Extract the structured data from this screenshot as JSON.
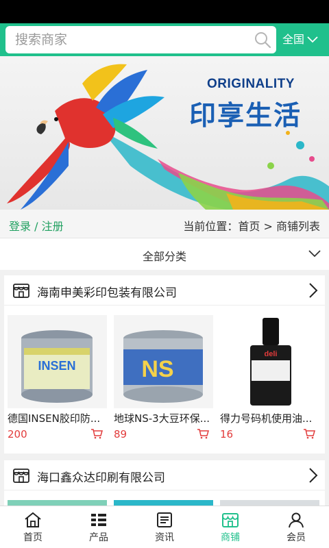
{
  "search": {
    "placeholder": "搜索商家",
    "region": "全国"
  },
  "banner": {
    "title_en": "ORIGINALITY",
    "title_cn": "印享生活"
  },
  "breadcrumb": {
    "login": "登录 / 注册",
    "location": "当前位置：首页 > 商铺列表"
  },
  "category": {
    "label": "全部分类"
  },
  "shops": [
    {
      "name": "海南申美彩印包装有限公司",
      "products": [
        {
          "title": "德国INSEN胶印防...",
          "price": "200",
          "image_label": "INSEN"
        },
        {
          "title": "地球NS-3大豆环保...",
          "price": "89",
          "image_label": "NS"
        },
        {
          "title": "得力号码机使用油...",
          "price": "16",
          "image_label": "deli"
        }
      ]
    },
    {
      "name": "海口鑫众达印刷有限公司"
    }
  ],
  "tabs": [
    {
      "label": "首页"
    },
    {
      "label": "产品"
    },
    {
      "label": "资讯"
    },
    {
      "label": "商铺"
    },
    {
      "label": "会员"
    }
  ],
  "colors": {
    "accent": "#20c08c",
    "price": "#e23b3b",
    "login": "#20a060"
  }
}
